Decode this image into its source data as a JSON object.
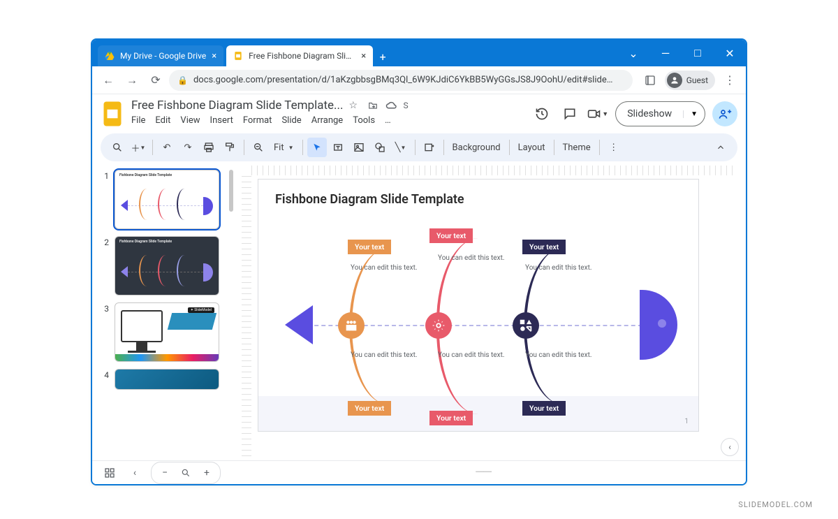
{
  "browser": {
    "tabs": [
      {
        "title": "My Drive - Google Drive",
        "active": false
      },
      {
        "title": "Free Fishbone Diagram Slide Tem",
        "active": true
      }
    ],
    "url": "docs.google.com/presentation/d/1aKzgbbsgBMq3Ql_6W9KJdiC6YkBB5WyGGsJS8J9OohU/edit#slide…",
    "guest_label": "Guest"
  },
  "window_controls": {
    "dropdown": "⌄",
    "minimize": "—",
    "maximize": "□",
    "close": "✕"
  },
  "app": {
    "doc_title": "Free Fishbone Diagram Slide Template...",
    "save_state": "S",
    "menus": [
      "File",
      "Edit",
      "View",
      "Insert",
      "Format",
      "Slide",
      "Arrange",
      "Tools",
      "…"
    ],
    "slideshow_label": "Slideshow"
  },
  "toolbar": {
    "zoom_label": "Fit",
    "buttons_right": [
      "Background",
      "Layout",
      "Theme"
    ]
  },
  "filmstrip": {
    "slides": [
      {
        "n": "1",
        "title": "Fishbone Diagram Slide Template",
        "bg": "#ffffff",
        "active": true
      },
      {
        "n": "2",
        "title": "Fishbone Diagram Slide Template",
        "bg": "#2f3640",
        "active": false
      },
      {
        "n": "3",
        "title": "",
        "bg": "#ffffff",
        "active": false
      },
      {
        "n": "4",
        "title": "",
        "bg": "#1e7aa8",
        "active": false
      }
    ]
  },
  "slide": {
    "title": "Fishbone Diagram Slide Template",
    "page_number": "1",
    "edit_text": "You can edit this text.",
    "bones": [
      {
        "color": "#e8954e",
        "label_bg": "#e8954e",
        "label": "Your text",
        "icon": "people"
      },
      {
        "color": "#e85a6a",
        "label_bg": "#e85a6a",
        "label": "Your text",
        "icon": "gear"
      },
      {
        "color": "#2c2a55",
        "label_bg": "#2c2a55",
        "label": "Your text",
        "icon": "shapes"
      }
    ]
  },
  "attribution": "SLIDEMODEL.COM"
}
